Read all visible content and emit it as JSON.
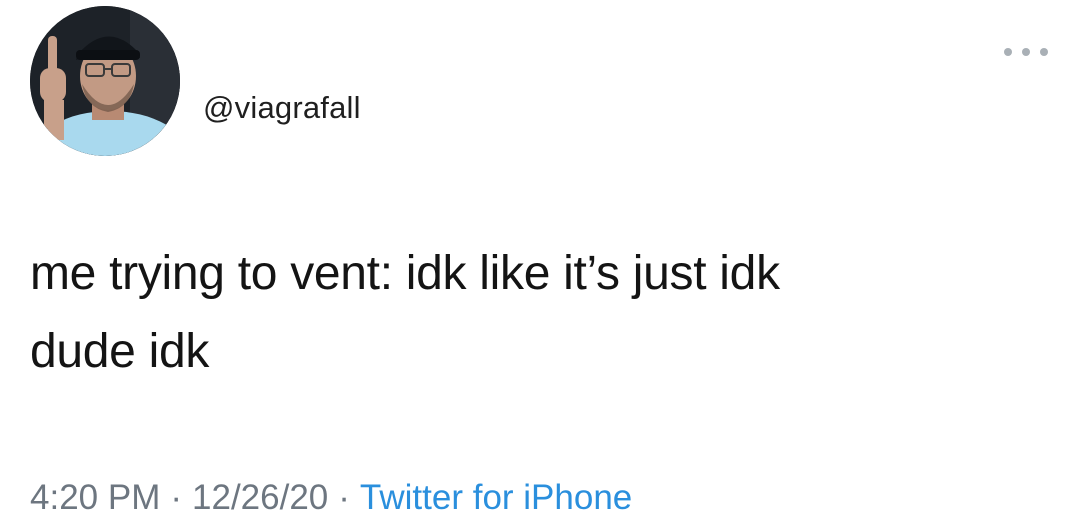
{
  "tweet": {
    "avatar_icon": "user-avatar-photo",
    "handle": "@viagrafall",
    "more_icon": "more-options-icon",
    "text": "me trying to vent: idk like it’s just idk\ndude idk",
    "time": "4:20 PM",
    "date": "12/26/20",
    "separator": "·",
    "source": "Twitter for iPhone"
  },
  "colors": {
    "text": "#141414",
    "meta": "#6d7680",
    "link": "#2a8fdd",
    "more_dots": "#a9b0b6"
  }
}
